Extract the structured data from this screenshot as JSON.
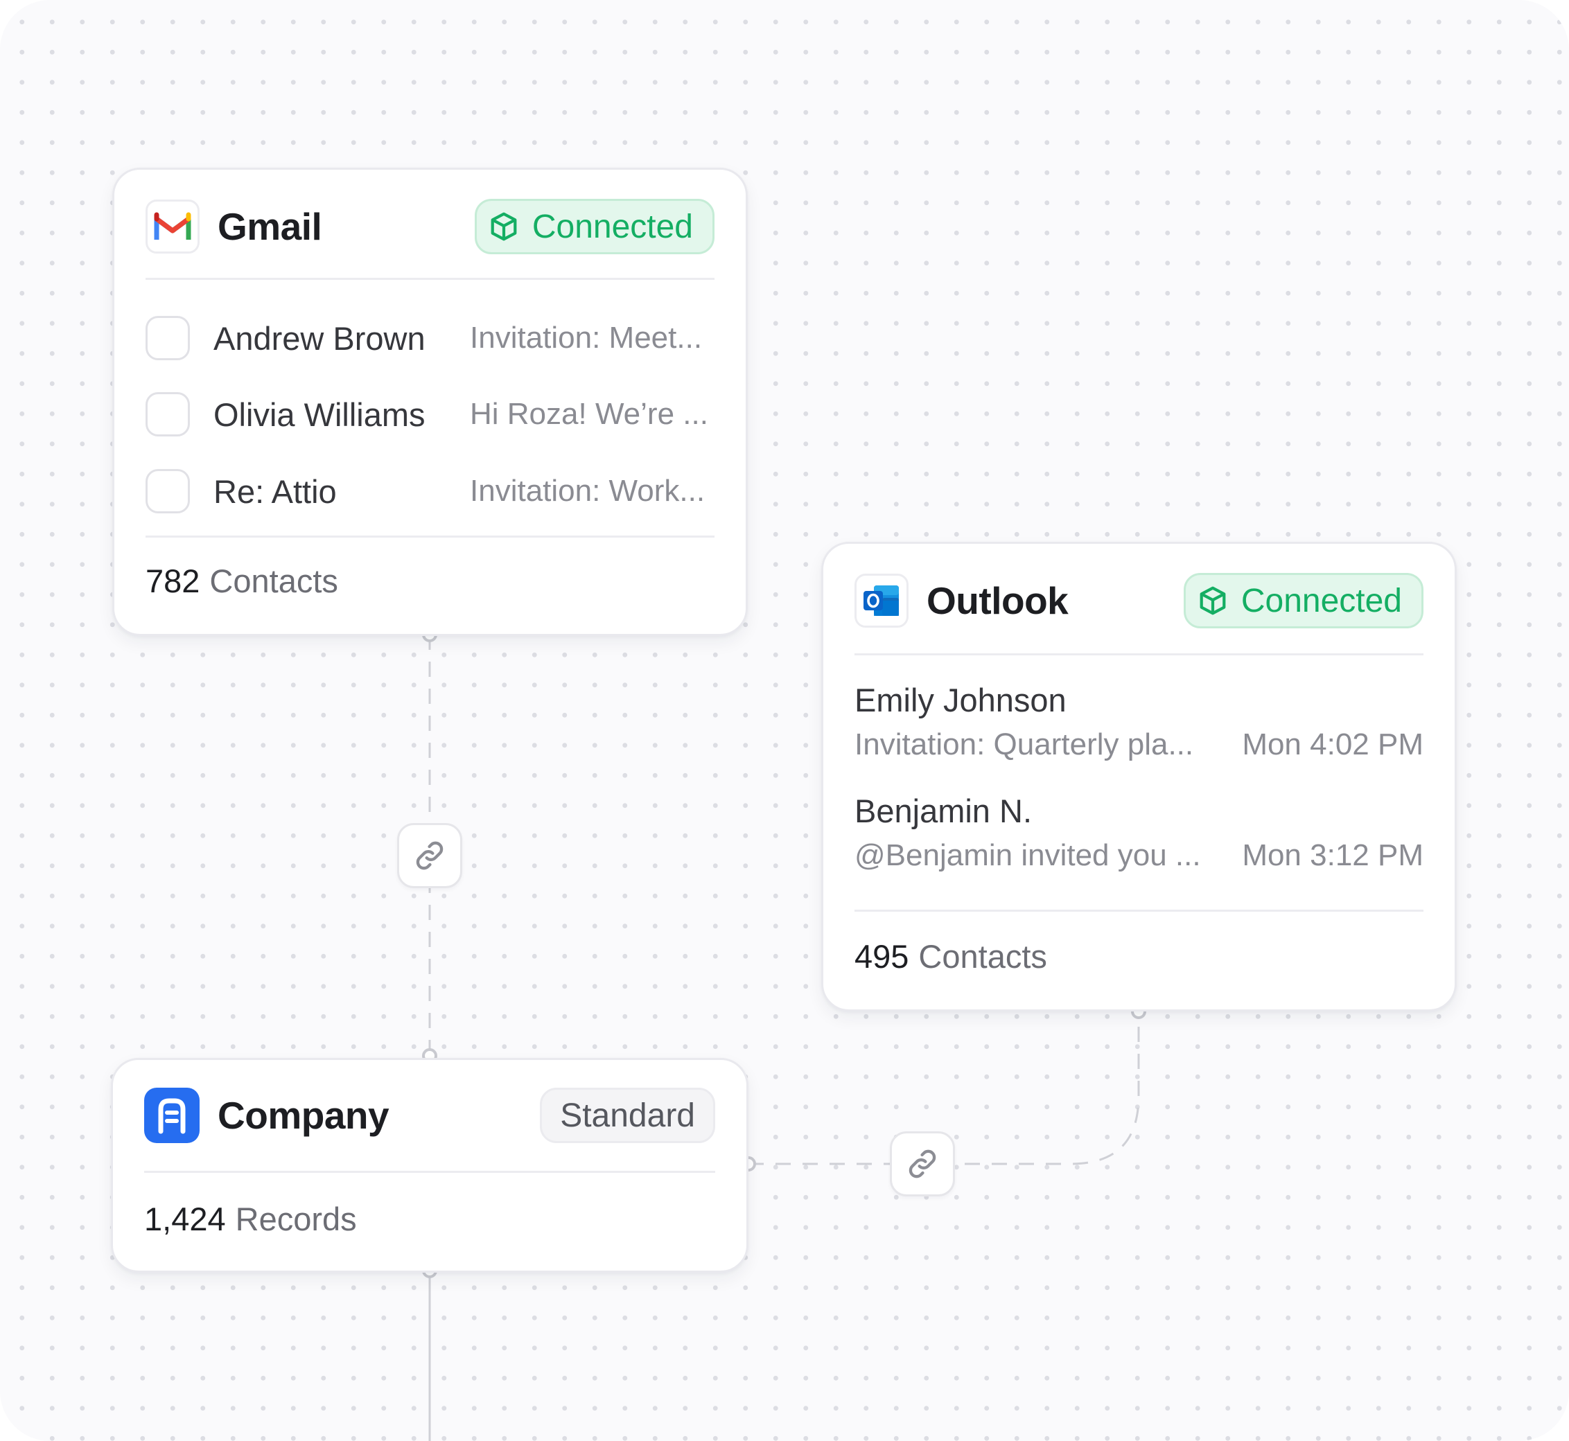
{
  "gmail": {
    "title": "Gmail",
    "icon": "gmail-icon",
    "status": "Connected",
    "rows": [
      {
        "sender": "Andrew Brown",
        "subject": "Invitation: Meet..."
      },
      {
        "sender": "Olivia Williams",
        "subject": "Hi Roza! We’re ..."
      },
      {
        "sender": "Re: Attio",
        "subject": "Invitation: Work..."
      }
    ],
    "count": "782",
    "count_label": "Contacts"
  },
  "outlook": {
    "title": "Outlook",
    "icon": "outlook-icon",
    "status": "Connected",
    "messages": [
      {
        "name": "Emily Johnson",
        "preview": "Invitation: Quarterly pla...",
        "time": "Mon 4:02 PM"
      },
      {
        "name": "Benjamin N.",
        "preview": "@Benjamin invited you ...",
        "time": "Mon 3:12 PM"
      }
    ],
    "count": "495",
    "count_label": "Contacts"
  },
  "company": {
    "title": "Company",
    "icon": "company-icon",
    "tag": "Standard",
    "count": "1,424",
    "count_label": "Records"
  },
  "colors": {
    "connected_text": "#14ae63",
    "connected_bg": "#e3f7ec",
    "company_blue": "#266df0",
    "outlook_blue": "#0a64c9"
  },
  "icons": [
    "link-icon",
    "box-icon"
  ]
}
